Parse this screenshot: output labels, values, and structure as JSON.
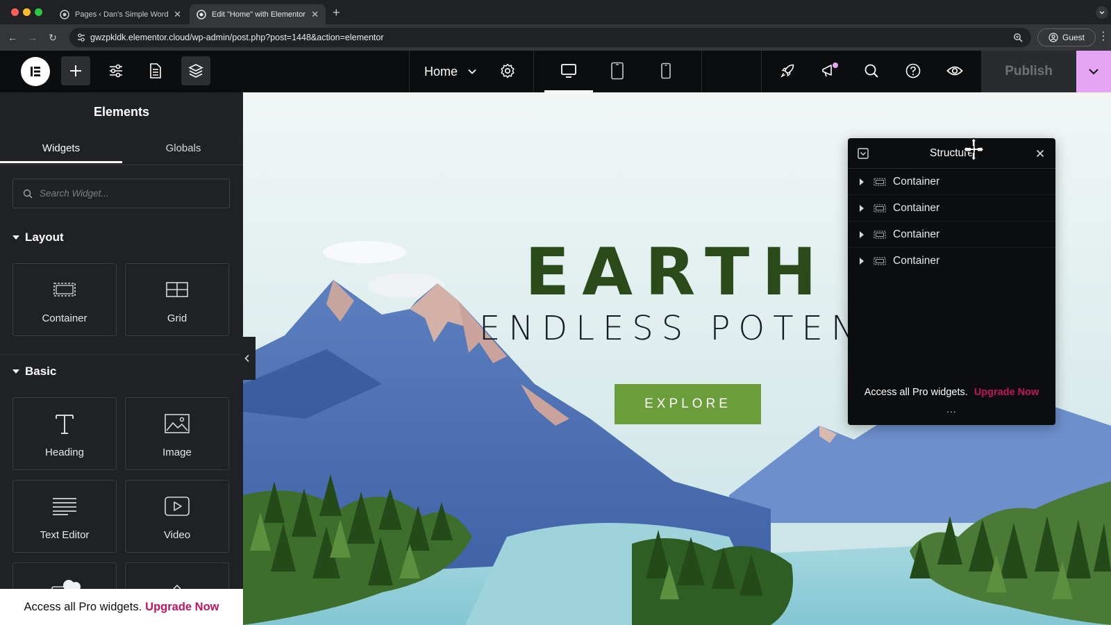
{
  "browser": {
    "tabs": [
      {
        "title": "Pages ‹ Dan's Simple WordPr",
        "active": false
      },
      {
        "title": "Edit \"Home\" with Elementor",
        "active": true
      }
    ],
    "new_tab_icon": "plus-icon",
    "url": "gwzpkldk.elementor.cloud/wp-admin/post.php?post=1448&action=elementor",
    "profile_label": "Guest"
  },
  "toolbar": {
    "page_name": "Home",
    "publish_label": "Publish",
    "accent": "#e8a4f4",
    "icons": [
      "elementor-logo-icon",
      "add-element-icon",
      "site-settings-icon",
      "page-settings-icon",
      "structure-icon",
      "page-settings-gear-icon",
      "desktop-icon",
      "tablet-icon",
      "mobile-icon",
      "rocket-icon",
      "megaphone-icon",
      "search-icon",
      "help-icon",
      "preview-eye-icon",
      "chevron-down-icon"
    ]
  },
  "panel": {
    "title": "Elements",
    "tabs": [
      "Widgets",
      "Globals"
    ],
    "search_placeholder": "Search Widget...",
    "categories": [
      {
        "name": "Layout",
        "widgets": [
          "Container",
          "Grid"
        ]
      },
      {
        "name": "Basic",
        "widgets": [
          "Heading",
          "Image",
          "Text Editor",
          "Video"
        ]
      }
    ],
    "promo_text": "Access all Pro widgets.",
    "promo_link": "Upgrade Now"
  },
  "canvas": {
    "title": "EARTH",
    "subtitle": "ENDLESS POTENTI",
    "button_label": "EXPLORE",
    "title_color": "#2b4a19",
    "button_color": "#6c9d3b"
  },
  "structure": {
    "title": "Structure",
    "items": [
      "Container",
      "Container",
      "Container",
      "Container"
    ],
    "promo_text": "Access all Pro widgets.",
    "promo_link": "Upgrade Now",
    "more": "..."
  }
}
